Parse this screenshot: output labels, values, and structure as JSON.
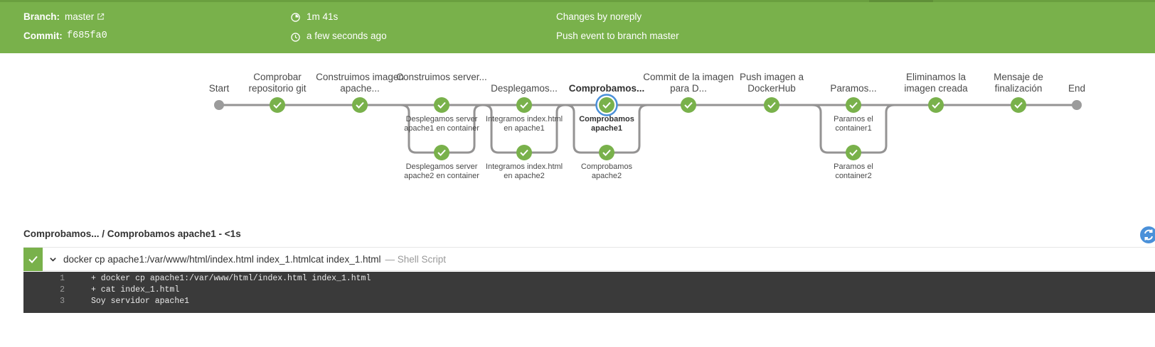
{
  "header": {
    "branch_label": "Branch:",
    "branch_value": "master",
    "commit_label": "Commit:",
    "commit_value": "f685fa0",
    "duration": "1m 41s",
    "time_ago": "a few seconds ago",
    "changes": "Changes by noreply",
    "event": "Push event to branch master",
    "status_color": "#79b14b"
  },
  "pipeline": {
    "stages": [
      {
        "id": "start",
        "label": "Start",
        "kind": "terminal"
      },
      {
        "id": "comprobar",
        "label": "Comprobar repositorio git",
        "kind": "success"
      },
      {
        "id": "construimos-imagen",
        "label": "Construimos imagen apache...",
        "kind": "success"
      },
      {
        "id": "construimos-server",
        "label": "Construimos server...",
        "kind": "success",
        "parallel": [
          "Desplegamos server apache1 en container",
          "Desplegamos server apache2 en container"
        ]
      },
      {
        "id": "desplegamos",
        "label": "Desplegamos...",
        "kind": "success",
        "parallel": [
          "Integramos index.html en apache1",
          "Integramos index.html en apache2"
        ]
      },
      {
        "id": "comprobamos",
        "label": "Comprobamos...",
        "kind": "success",
        "selected": true,
        "parallel": [
          "Comprobamos apache1",
          "Comprobamos apache2"
        ]
      },
      {
        "id": "commit",
        "label": "Commit de la imagen para D...",
        "kind": "success"
      },
      {
        "id": "push",
        "label": "Push imagen a DockerHub",
        "kind": "success"
      },
      {
        "id": "paramos",
        "label": "Paramos...",
        "kind": "success",
        "parallel": [
          "Paramos el container1",
          "Paramos el container2"
        ]
      },
      {
        "id": "eliminamos",
        "label": "Eliminamos la imagen creada",
        "kind": "success"
      },
      {
        "id": "mensaje",
        "label": "Mensaje de finalización",
        "kind": "success"
      },
      {
        "id": "end",
        "label": "End",
        "kind": "terminal"
      }
    ],
    "selected_parallel": "Comprobamos apache1",
    "success_color": "#79b14b",
    "selected_color": "#4a90d9"
  },
  "log": {
    "title": "Comprobamos... / Comprobamos apache1 - <1s",
    "step_command": "docker cp apache1:/var/www/html/index.html index_1.htmlcat index_1.html",
    "step_type": "— Shell Script",
    "lines": [
      {
        "num": "1",
        "text": "+ docker cp apache1:/var/www/html/index.html index_1.html"
      },
      {
        "num": "2",
        "text": "+ cat index_1.html"
      },
      {
        "num": "3",
        "text": "Soy servidor apache1"
      }
    ]
  }
}
